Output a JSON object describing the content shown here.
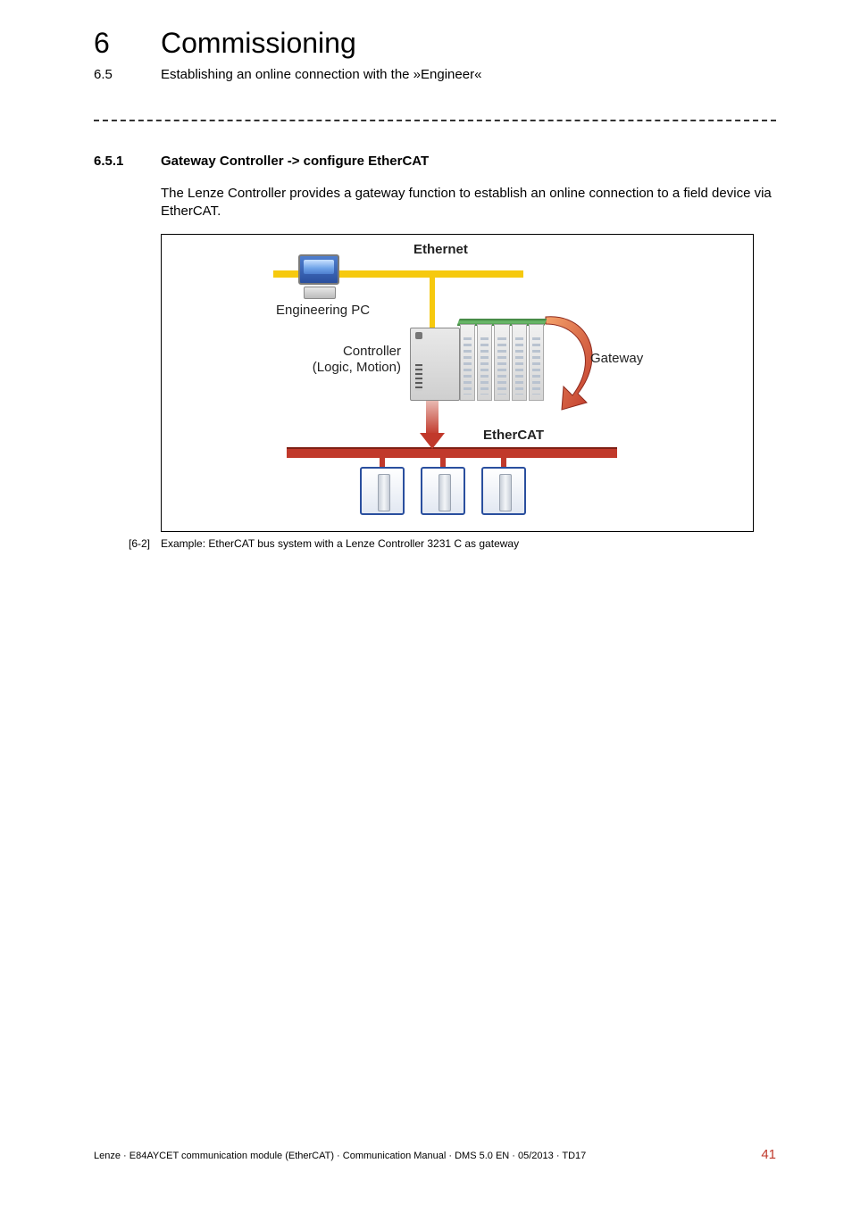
{
  "header": {
    "chapter_number": "6",
    "chapter_title": "Commissioning",
    "section_number": "6.5",
    "section_title": "Establishing an online connection with the »Engineer«"
  },
  "subsection": {
    "number": "6.5.1",
    "title": "Gateway Controller -> configure EtherCAT"
  },
  "body": {
    "paragraph": "The Lenze Controller provides a gateway function to establish an online connection to a field device via EtherCAT."
  },
  "figure": {
    "labels": {
      "ethernet": "Ethernet",
      "engineering_pc": "Engineering PC",
      "controller_line1": "Controller",
      "controller_line2": "(Logic, Motion)",
      "gateway": "Gateway",
      "ethercat": "EtherCAT"
    },
    "caption_number": "[6-2]",
    "caption_text": "Example: EtherCAT bus system with a Lenze Controller 3231 C as gateway"
  },
  "footer": {
    "text": "Lenze · E84AYCET communication module (EtherCAT) · Communication Manual · DMS 5.0 EN · 05/2013 · TD17",
    "page": "41"
  }
}
